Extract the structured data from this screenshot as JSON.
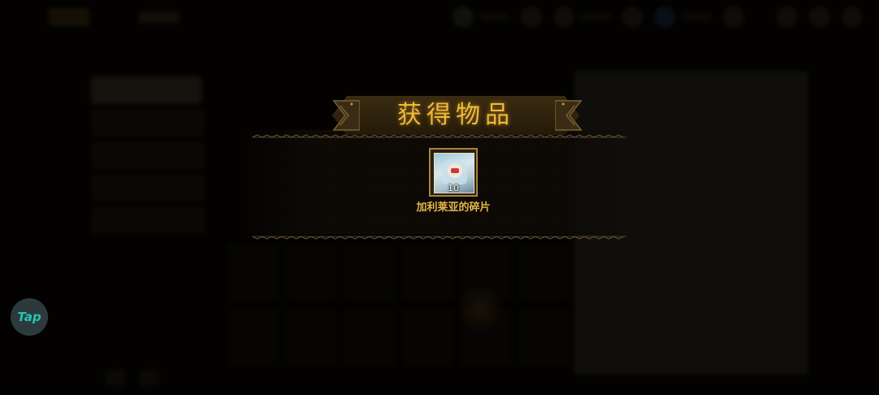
{
  "reward": {
    "title": "获得物品",
    "item": {
      "name": "加利莱亚的碎片",
      "count": "10",
      "icon": "character-fragment-icon"
    }
  },
  "overlay_badge": {
    "label": "Tap"
  },
  "colors": {
    "title_gold": "#f0b938",
    "item_name_gold": "#e7b54a",
    "item_frame": "#a8823a",
    "tap_teal": "#27c3b6"
  }
}
